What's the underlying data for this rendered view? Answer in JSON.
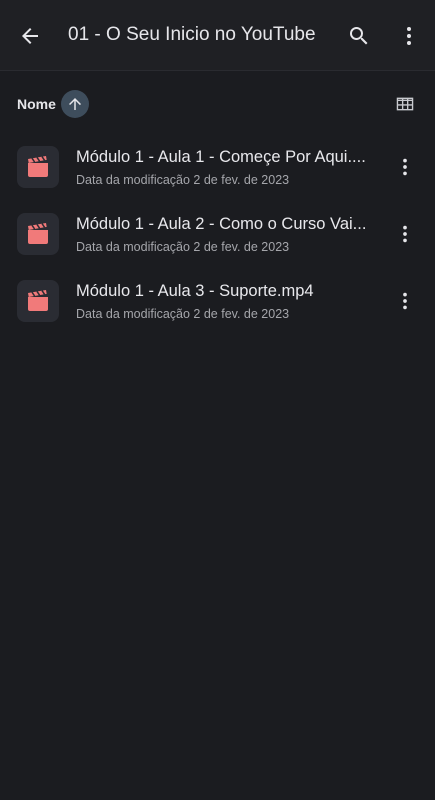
{
  "app": {
    "title": "01 - O Seu Inicio no YouTube"
  },
  "sort": {
    "label": "Nome",
    "direction": "ascending"
  },
  "files": [
    {
      "name": "Módulo 1 - Aula 1 - Começe Por Aqui....",
      "meta": "Data da modificação 2 de fev. de 2023",
      "icon": "video-file-icon"
    },
    {
      "name": "Módulo 1 - Aula 2 - Como o Curso Vai...",
      "meta": "Data da modificação 2 de fev. de 2023",
      "icon": "video-file-icon"
    },
    {
      "name": "Módulo 1 - Aula 3 - Suporte.mp4",
      "meta": "Data da modificação 2 de fev. de 2023",
      "icon": "video-file-icon"
    }
  ],
  "colors": {
    "background": "#1b1c20",
    "accent_sort": "#3e4d5c",
    "video_icon": "#f17a7a"
  }
}
